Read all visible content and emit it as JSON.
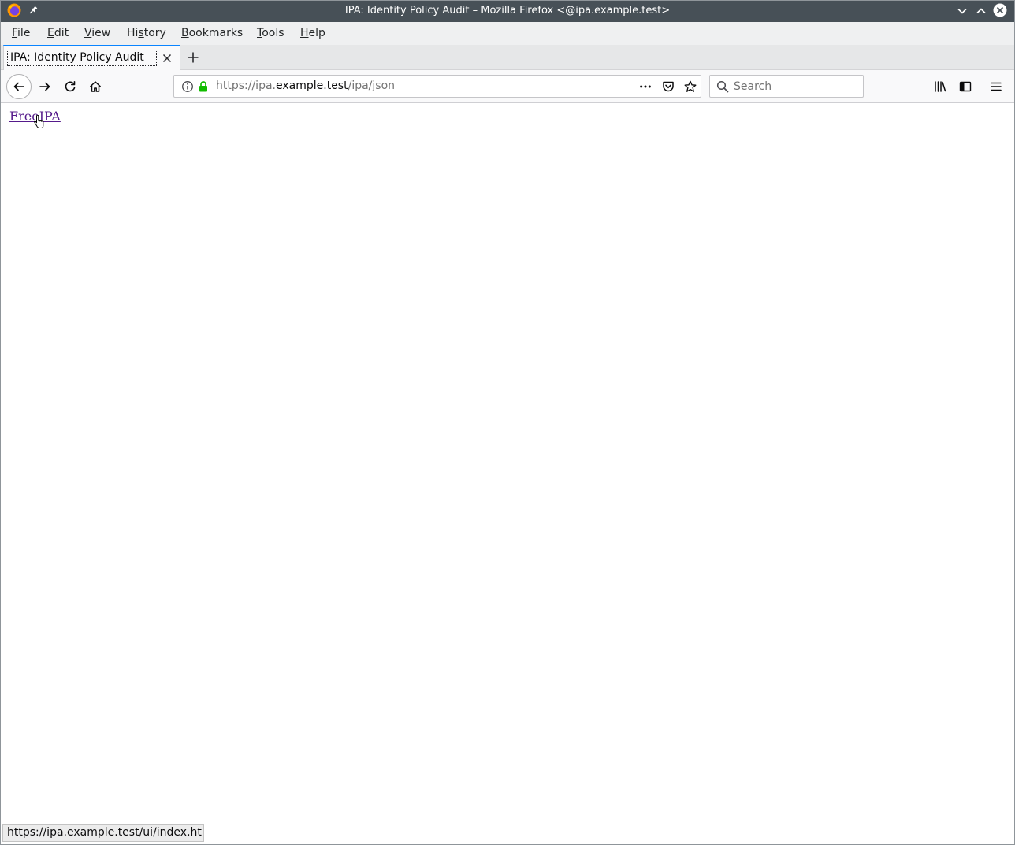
{
  "window": {
    "title": "IPA: Identity Policy Audit – Mozilla Firefox <@ipa.example.test>"
  },
  "menu": {
    "items": [
      {
        "pre": "",
        "key": "F",
        "post": "ile"
      },
      {
        "pre": "",
        "key": "E",
        "post": "dit"
      },
      {
        "pre": "",
        "key": "V",
        "post": "iew"
      },
      {
        "pre": "Hi",
        "key": "s",
        "post": "tory"
      },
      {
        "pre": "",
        "key": "B",
        "post": "ookmarks"
      },
      {
        "pre": "",
        "key": "T",
        "post": "ools"
      },
      {
        "pre": "",
        "key": "H",
        "post": "elp"
      }
    ]
  },
  "tabs": [
    {
      "label": "IPA: Identity Policy Audit",
      "selected": true
    }
  ],
  "urlbar": {
    "url_prefix": "https://ipa.",
    "url_domain": "example.test",
    "url_path": "/ipa/json"
  },
  "search": {
    "placeholder": "Search"
  },
  "page": {
    "link_text": "FreeIPA"
  },
  "status": {
    "text": "https://ipa.example.test/ui/index.html"
  },
  "colors": {
    "titlebar": "#475057",
    "accent": "#0a84ff",
    "link_visited": "#551a8b",
    "secure_lock": "#12bc00"
  },
  "icons": {
    "titlebar": [
      "firefox-logo-icon",
      "pin-icon",
      "minimize-chevron-icon",
      "maximize-chevron-icon",
      "close-icon"
    ],
    "tabs": [
      "tab-close-icon",
      "new-tab-plus-icon"
    ],
    "navigation": [
      "back-arrow-icon",
      "forward-arrow-icon",
      "reload-icon",
      "home-icon"
    ],
    "urlbar": [
      "info-icon",
      "lock-icon",
      "more-dots-icon",
      "pocket-icon",
      "bookmark-star-icon"
    ],
    "search": [
      "search-icon"
    ],
    "toolbar": [
      "library-icon",
      "sidebar-icon",
      "hamburger-menu-icon"
    ],
    "content": [
      "hand-cursor-icon"
    ]
  }
}
